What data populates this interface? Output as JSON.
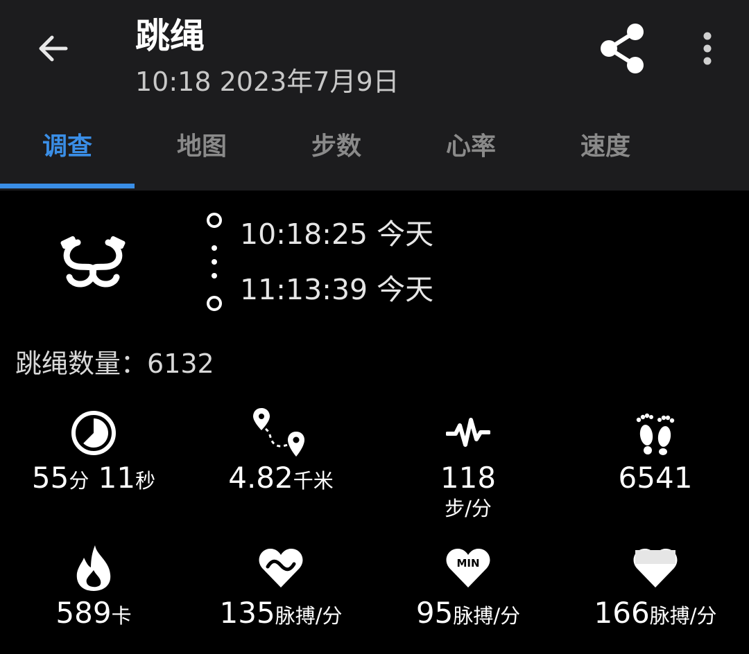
{
  "header": {
    "title": "跳绳",
    "subtitle": "10:18 2023年7月9日",
    "icons": {
      "back": "arrow-left-icon",
      "share": "share-icon",
      "more": "more-vert-icon"
    }
  },
  "tabs": [
    {
      "label": "调查",
      "active": true
    },
    {
      "label": "地图",
      "active": false
    },
    {
      "label": "步数",
      "active": false
    },
    {
      "label": "心率",
      "active": false
    },
    {
      "label": "速度",
      "active": false
    }
  ],
  "session": {
    "icon": "jump-rope-icon",
    "start_time": "10:18:25 今天",
    "end_time": "11:13:39 今天"
  },
  "jump_count": {
    "label": "跳绳数量：",
    "value": "6132"
  },
  "stats": [
    {
      "icon": "timer-icon",
      "value": "55",
      "unit": "分",
      "value2": " 11",
      "unit2": "秒"
    },
    {
      "icon": "route-icon",
      "value": "4.82",
      "unit": "千米"
    },
    {
      "icon": "cadence-icon",
      "value": "118",
      "unit": "步/分"
    },
    {
      "icon": "footsteps-icon",
      "value": "6541"
    },
    {
      "icon": "flame-icon",
      "value": "589",
      "unit": "卡"
    },
    {
      "icon": "heart-avg-icon",
      "value": "135",
      "unit": "脉搏/分"
    },
    {
      "icon": "heart-min-icon",
      "value": "95",
      "unit": "脉搏/分",
      "badge": "MIN"
    },
    {
      "icon": "heart-max-icon",
      "value": "166",
      "unit": "脉搏/分"
    }
  ],
  "colors": {
    "accent": "#3a8ee6",
    "header_bg": "#1c1c1e",
    "background": "#000000"
  }
}
